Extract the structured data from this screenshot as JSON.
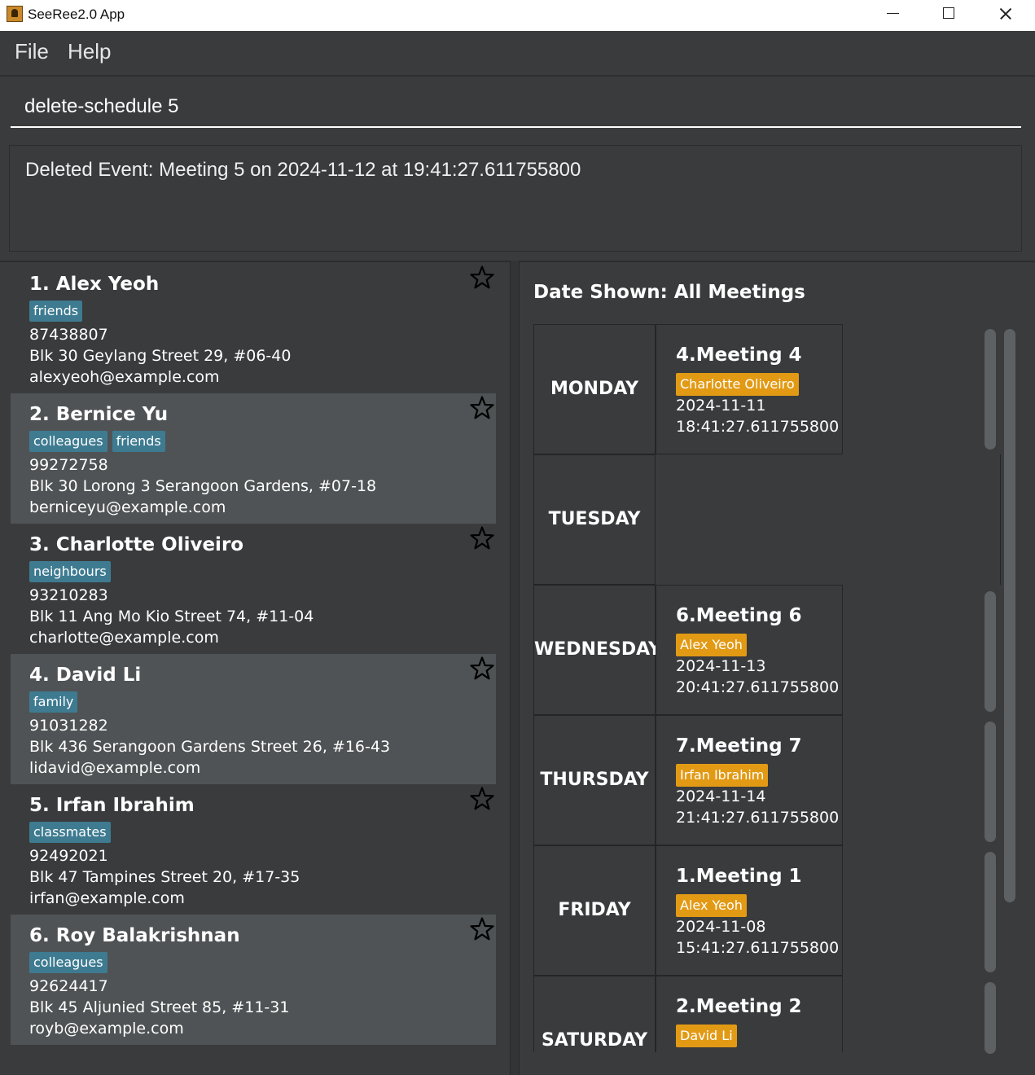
{
  "window": {
    "title": "SeeRee2.0 App"
  },
  "menu": {
    "file": "File",
    "help": "Help"
  },
  "command": {
    "value": "delete-schedule 5"
  },
  "result": {
    "text": "Deleted Event: Meeting 5 on 2024-11-12 at 19:41:27.611755800"
  },
  "persons": [
    {
      "name": "1. Alex Yeoh",
      "tags": [
        "friends"
      ],
      "phone": "87438807",
      "address": "Blk 30 Geylang Street 29, #06-40",
      "email": "alexyeoh@example.com"
    },
    {
      "name": "2. Bernice Yu",
      "tags": [
        "colleagues",
        "friends"
      ],
      "phone": "99272758",
      "address": "Blk 30 Lorong 3 Serangoon Gardens, #07-18",
      "email": "berniceyu@example.com"
    },
    {
      "name": "3. Charlotte Oliveiro",
      "tags": [
        "neighbours"
      ],
      "phone": "93210283",
      "address": "Blk 11 Ang Mo Kio Street 74, #11-04",
      "email": "charlotte@example.com"
    },
    {
      "name": "4. David Li",
      "tags": [
        "family"
      ],
      "phone": "91031282",
      "address": "Blk 436 Serangoon Gardens Street 26, #16-43",
      "email": "lidavid@example.com"
    },
    {
      "name": "5. Irfan Ibrahim",
      "tags": [
        "classmates"
      ],
      "phone": "92492021",
      "address": "Blk 47 Tampines Street 20, #17-35",
      "email": "irfan@example.com"
    },
    {
      "name": "6. Roy Balakrishnan",
      "tags": [
        "colleagues"
      ],
      "phone": "92624417",
      "address": "Blk 45 Aljunied Street 85, #11-31",
      "email": "royb@example.com"
    }
  ],
  "schedule": {
    "heading": "Date Shown: All Meetings",
    "days": [
      {
        "day": "MONDAY",
        "meeting": {
          "title": "4.Meeting 4",
          "person": "Charlotte Oliveiro",
          "date": "2024-11-11",
          "time": "18:41:27.611755800"
        }
      },
      {
        "day": "TUESDAY",
        "meeting": null
      },
      {
        "day": "WEDNESDAY",
        "meeting": {
          "title": "6.Meeting 6",
          "person": "Alex Yeoh",
          "date": "2024-11-13",
          "time": "20:41:27.611755800"
        }
      },
      {
        "day": "THURSDAY",
        "meeting": {
          "title": "7.Meeting 7",
          "person": "Irfan Ibrahim",
          "date": "2024-11-14",
          "time": "21:41:27.611755800"
        }
      },
      {
        "day": "FRIDAY",
        "meeting": {
          "title": "1.Meeting 1",
          "person": "Alex Yeoh",
          "date": "2024-11-08",
          "time": "15:41:27.611755800"
        }
      },
      {
        "day": "SATURDAY",
        "meeting": {
          "title": "2.Meeting 2",
          "person": "David Li",
          "date": "",
          "time": ""
        }
      }
    ]
  }
}
